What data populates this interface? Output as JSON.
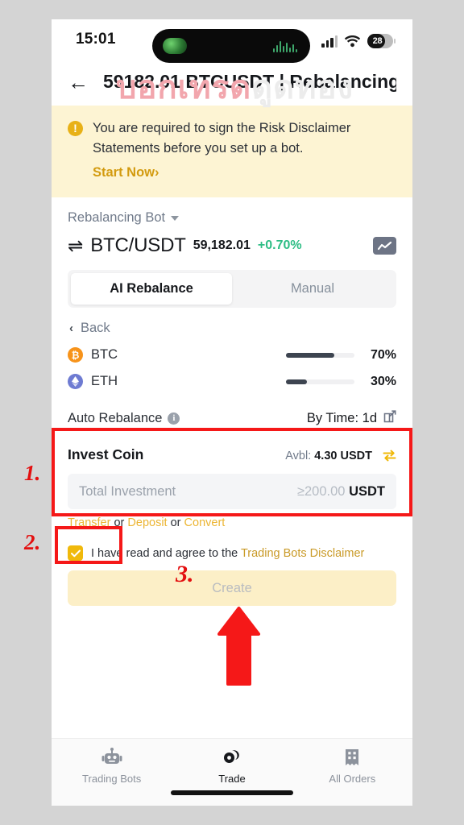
{
  "statusbar": {
    "time": "15:01",
    "battery_pct": "28",
    "signal_icon": "cellular-bars-icon",
    "wifi_icon": "wifi-icon",
    "battery_icon": "battery-icon"
  },
  "watermark": {
    "part_a": "บอกเทรด",
    "part_b": "ดูดทอง"
  },
  "header": {
    "back_icon": "arrow-left-icon",
    "title": "59182.01 BTCUSDT | Rebalancing..."
  },
  "notice": {
    "icon": "alert-circle-icon",
    "text": "You are required to sign the Risk Disclaimer Statements before you set up a bot.",
    "link_label": "Start Now ",
    "link_chevron": "›",
    "background": "#fdf4d3",
    "icon_color": "#e8b117",
    "link_color": "#d39b10"
  },
  "pair": {
    "bot_type": "Rebalancing Bot",
    "dropdown_icon": "chevron-down-icon",
    "swap_icon": "swap-vertical-icon",
    "symbol": "BTC/USDT",
    "price": "59,182.01",
    "change": "+0.70%",
    "change_color": "#2ebd85",
    "chart_icon": "line-chart-icon"
  },
  "tabs": [
    {
      "label": "AI Rebalance",
      "active": true
    },
    {
      "label": "Manual",
      "active": false
    }
  ],
  "back_link": {
    "chevron": "‹",
    "label": "Back"
  },
  "allocation": [
    {
      "coin": "BTC",
      "glyph": "₿",
      "icon": "bitcoin-icon",
      "color": "#f7931a",
      "percent": "70%",
      "value": 70
    },
    {
      "coin": "ETH",
      "glyph": "◆",
      "icon": "ethereum-icon",
      "color": "#6e7bd2",
      "percent": "30%",
      "value": 30
    }
  ],
  "auto_rebalance": {
    "label": "Auto Rebalance",
    "info_icon": "info-icon",
    "value": "By Time: 1d",
    "edit_icon": "edit-square-icon"
  },
  "invest": {
    "title": "Invest Coin",
    "available_label": "Avbl: ",
    "available_value": "4.30 USDT",
    "swap_icon": "transfer-arrows-icon",
    "input_placeholder": "Total Investment",
    "input_value": "",
    "min_hint": "≥200.00",
    "unit": "USDT",
    "fund_prefix": "",
    "fund_transfer": "Transfer",
    "fund_or_1": " or ",
    "fund_deposit": "Deposit",
    "fund_or_2": " or ",
    "fund_convert": "Convert",
    "link_color": "#ecb533"
  },
  "agreement": {
    "checked": true,
    "check_icon": "checkmark-icon",
    "text_before": "I have read and agree to the ",
    "link_label": "Trading Bots Disclaimer",
    "checkbox_color": "#f0b90b"
  },
  "create_button": {
    "label": "Create",
    "disabled": true,
    "background": "#fcefc7",
    "text_color": "#b9bcc0"
  },
  "bottom_nav": [
    {
      "label": "Trading Bots",
      "icon": "robot-icon",
      "active": false
    },
    {
      "label": "Trade",
      "icon": "coins-icon",
      "active": true
    },
    {
      "label": "All Orders",
      "icon": "orders-grid-icon",
      "active": false
    }
  ],
  "annotations": {
    "step_1": "1.",
    "step_2": "2.",
    "step_3": "3.",
    "arrow_icon": "up-arrow-annotation",
    "color": "#f51818"
  }
}
